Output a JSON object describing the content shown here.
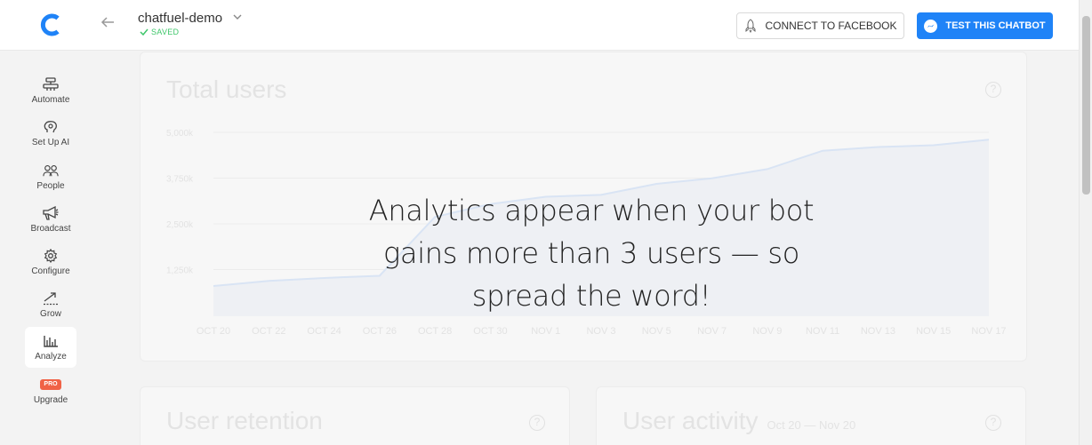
{
  "header": {
    "bot_name": "chatfuel-demo",
    "status": "SAVED",
    "connect_label": "CONNECT TO FACEBOOK",
    "test_label": "TEST THIS CHATBOT",
    "brand_color": "#1f83f7"
  },
  "sidebar": {
    "items": [
      {
        "label": "Automate",
        "icon": "automate-icon"
      },
      {
        "label": "Set Up AI",
        "icon": "brain-icon"
      },
      {
        "label": "People",
        "icon": "people-icon"
      },
      {
        "label": "Broadcast",
        "icon": "megaphone-icon"
      },
      {
        "label": "Configure",
        "icon": "gear-icon"
      },
      {
        "label": "Grow",
        "icon": "grow-icon"
      },
      {
        "label": "Analyze",
        "icon": "bar-chart-icon",
        "active": true
      },
      {
        "label": "Upgrade",
        "badge": "PRO"
      }
    ]
  },
  "main": {
    "total_users": {
      "title": "Total users"
    },
    "overlay_message": "Analytics appear when your bot gains more than 3 users — so spread the word!",
    "user_retention": {
      "title": "User retention"
    },
    "user_activity": {
      "title": "User activity",
      "subtitle": "Oct 20 — Nov 20"
    }
  },
  "chart_data": {
    "type": "area",
    "title": "Total users",
    "y_tick_labels": [
      "5,000k",
      "3,750k",
      "2,500k",
      "1,250k"
    ],
    "y_ticks": [
      5000,
      3750,
      2500,
      1250
    ],
    "ylim": [
      0,
      5000
    ],
    "x_tick_labels": [
      "OCT 20",
      "OCT 22",
      "OCT 24",
      "OCT 26",
      "OCT 28",
      "OCT 30",
      "NOV 1",
      "NOV 3",
      "NOV 5",
      "NOV 7",
      "NOV 9",
      "NOV 11",
      "NOV 13",
      "NOV 15",
      "NOV 17"
    ],
    "series": [
      {
        "values": [
          820,
          960,
          1040,
          1100,
          2700,
          3050,
          3250,
          3300,
          3600,
          3750,
          4000,
          4500,
          4600,
          4650,
          4800
        ]
      }
    ],
    "grid": true,
    "colors": {
      "line": "#d9e4f4",
      "fill": "#eef0f4",
      "text": "#e2e2e2"
    }
  }
}
